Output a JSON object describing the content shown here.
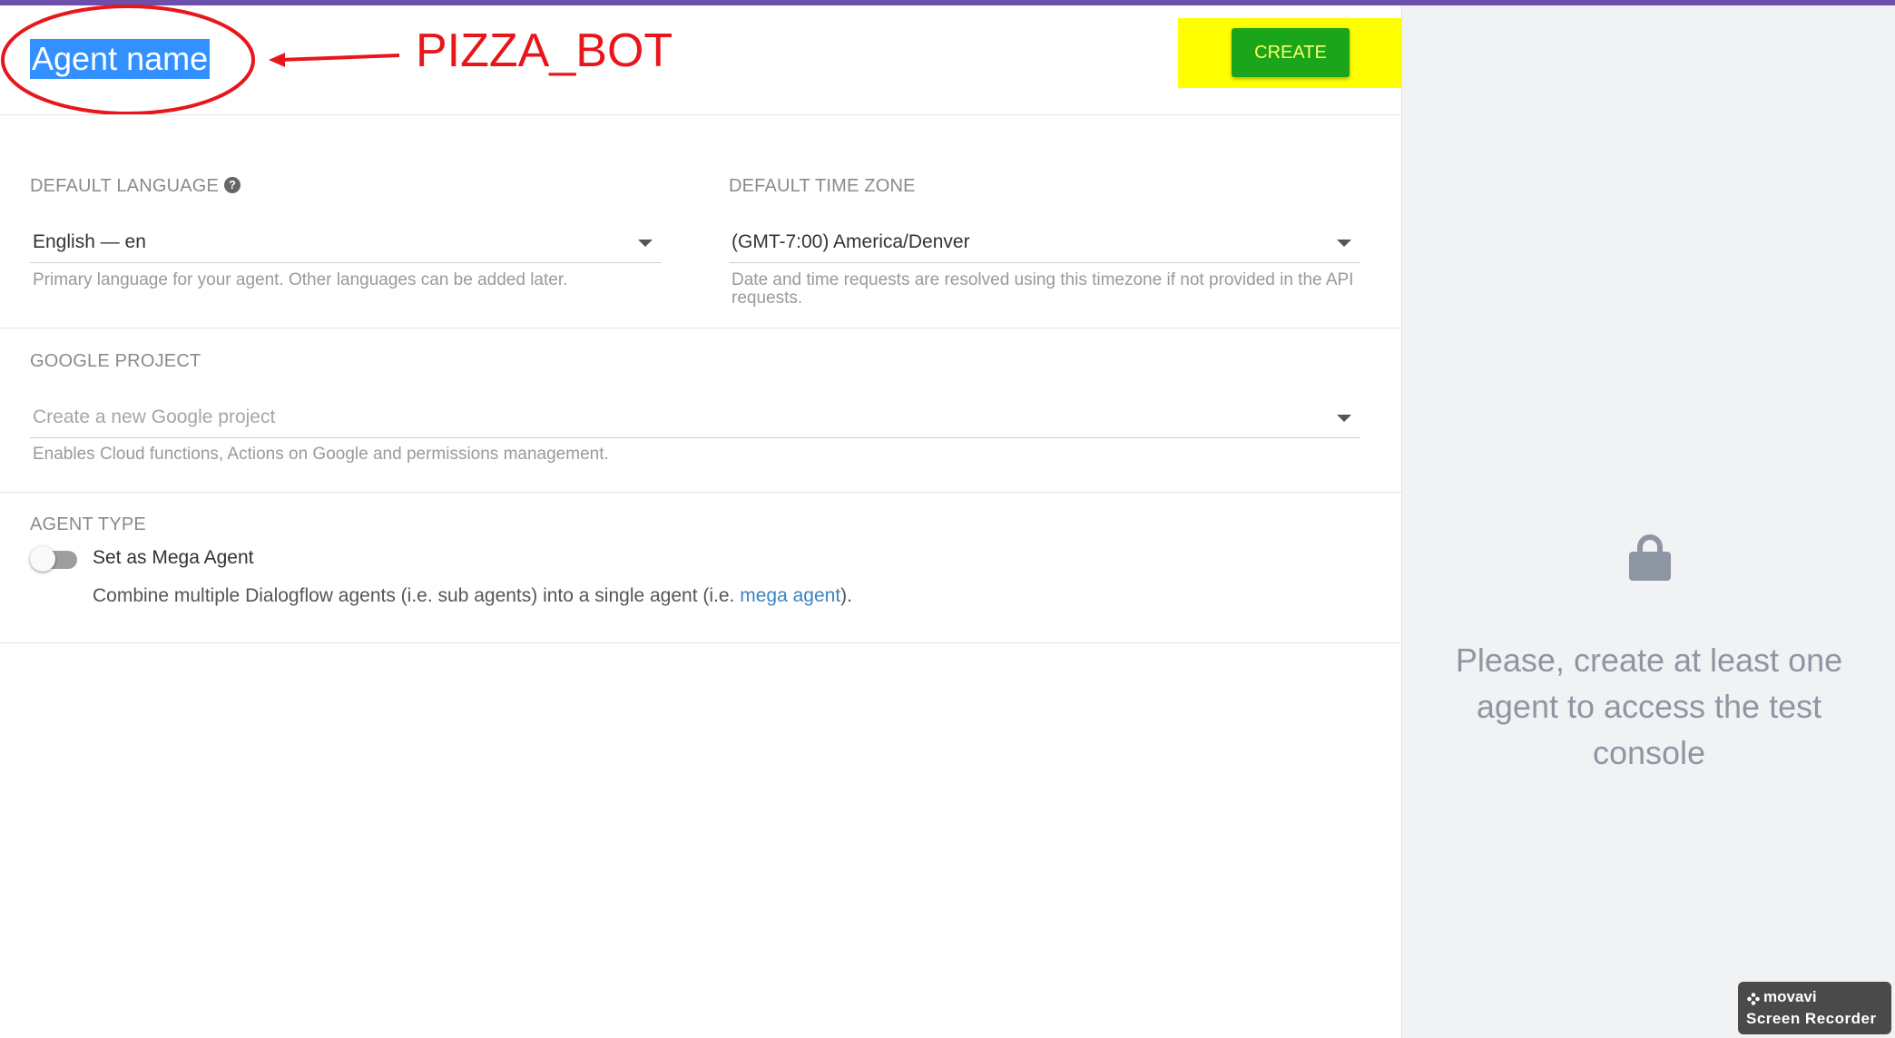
{
  "header": {
    "agent_name_placeholder": "Agent name",
    "create_label": "CREATE"
  },
  "annotation": {
    "text": "PIZZA_BOT",
    "color": "#e8161b"
  },
  "language": {
    "label": "DEFAULT LANGUAGE",
    "help_icon": "question-circle-icon",
    "value": "English — en",
    "hint": "Primary language for your agent. Other languages can be added later."
  },
  "timezone": {
    "label": "DEFAULT TIME ZONE",
    "value": "(GMT-7:00) America/Denver",
    "hint_line1": "Date and time requests are resolved using this timezone if not provided in the API",
    "hint_line2": "requests."
  },
  "project": {
    "label": "GOOGLE PROJECT",
    "placeholder": "Create a new Google project",
    "hint": "Enables Cloud functions, Actions on Google and permissions management."
  },
  "agent_type": {
    "label": "AGENT TYPE",
    "toggle_label": "Set as Mega Agent",
    "toggle_on": false,
    "desc_prefix": "Combine multiple Dialogflow agents (i.e. sub agents) into a single agent (i.e. ",
    "desc_link": "mega agent",
    "desc_suffix": ")."
  },
  "test_console": {
    "lock_icon": "lock-icon",
    "message_line1": "Please, create at least one",
    "message_line2": "agent to access the test",
    "message_line3": "console"
  },
  "watermark": {
    "brand": "movavi",
    "product": "Screen Recorder"
  },
  "colors": {
    "accent_bar": "#6b4fa8",
    "create_button": "#1aa51a",
    "highlight": "#ffff00",
    "link": "#3b82c4"
  }
}
